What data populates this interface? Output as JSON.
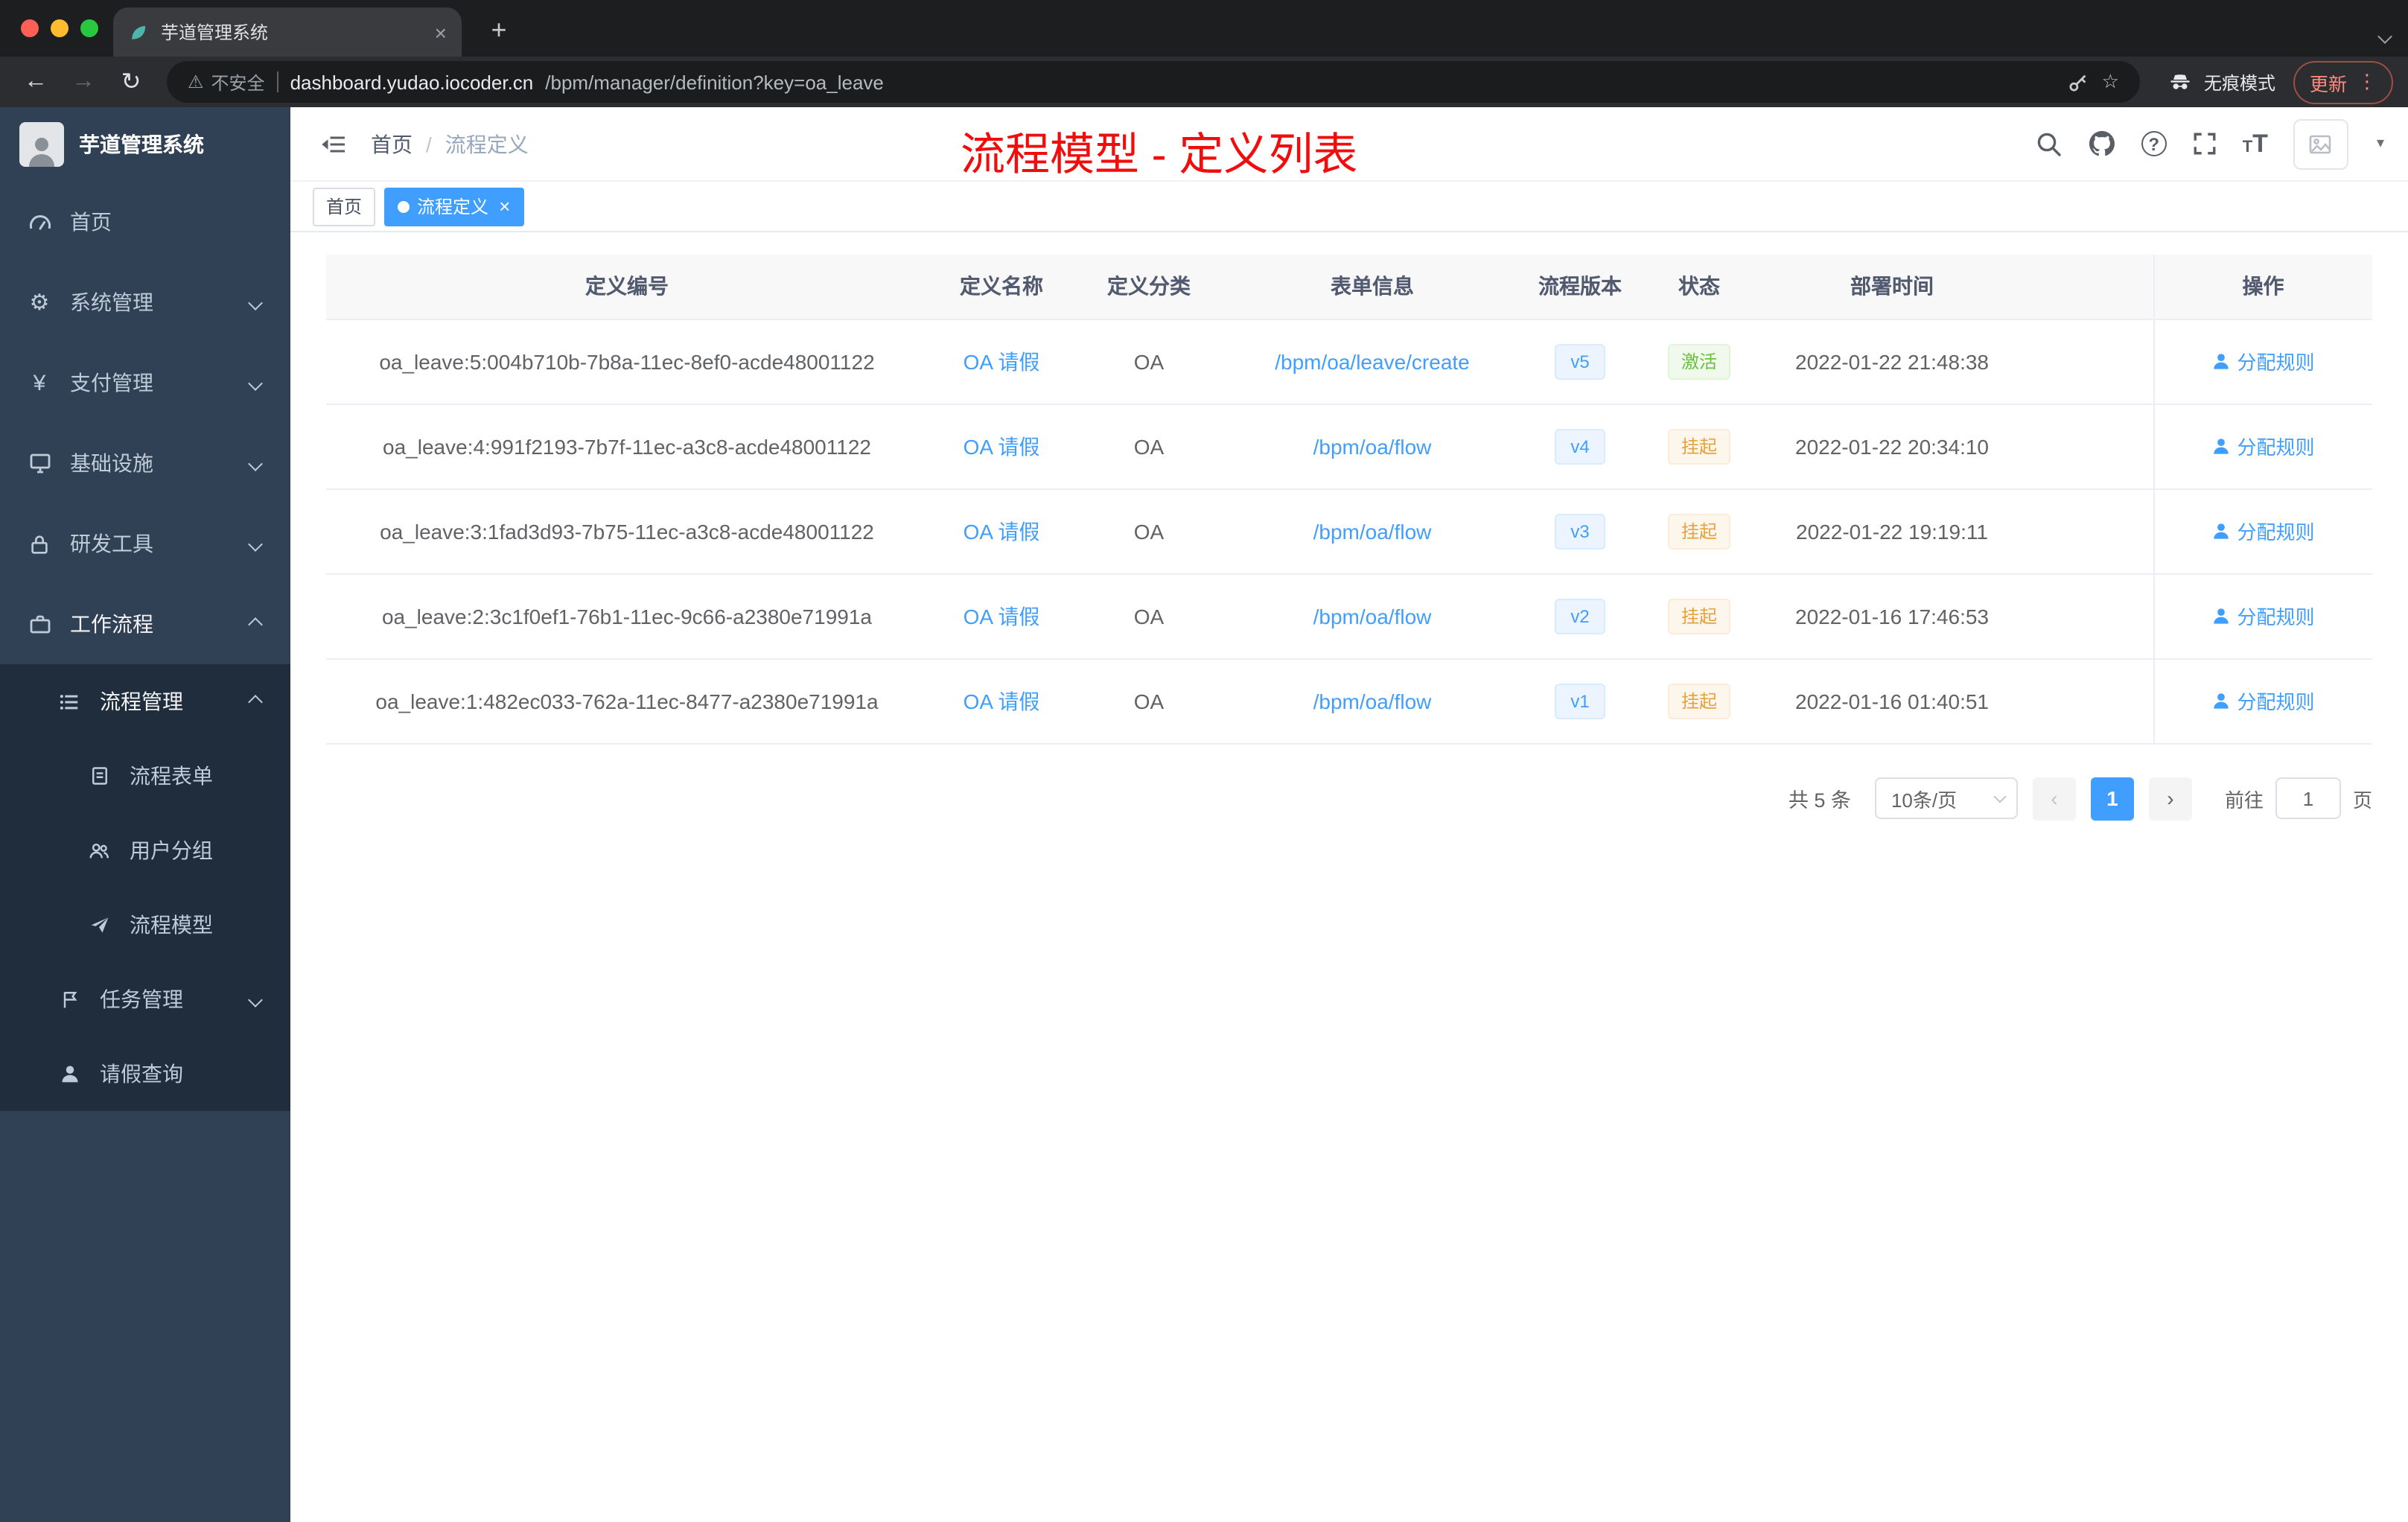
{
  "browser": {
    "tab_title": "芋道管理系统",
    "security_label": "不安全",
    "url_host": "dashboard.yudao.iocoder.cn",
    "url_path": "/bpm/manager/definition?key=oa_leave",
    "incognito_label": "无痕模式",
    "update_label": "更新"
  },
  "colors": {
    "accent": "#409eff",
    "success": "#67c23a",
    "warning": "#e6a23c",
    "title_red": "#f20d0d",
    "sidebar_bg": "#304156",
    "submenu_bg": "#1f2d3d"
  },
  "sidebar": {
    "logo_title": "芋道管理系统",
    "items": [
      {
        "label": "首页",
        "icon": "dashboard-icon"
      },
      {
        "label": "系统管理",
        "icon": "gear-icon"
      },
      {
        "label": "支付管理",
        "icon": "yen-icon"
      },
      {
        "label": "基础设施",
        "icon": "infrastructure-icon"
      },
      {
        "label": "研发工具",
        "icon": "dev-tools-icon"
      },
      {
        "label": "工作流程",
        "icon": "workflow-icon"
      }
    ],
    "workflow": {
      "process_mgmt": {
        "label": "流程管理",
        "icon": "process-list-icon"
      },
      "children": [
        {
          "label": "流程表单",
          "icon": "form-icon"
        },
        {
          "label": "用户分组",
          "icon": "user-group-icon"
        },
        {
          "label": "流程模型",
          "icon": "process-model-icon"
        }
      ],
      "task_mgmt": {
        "label": "任务管理",
        "icon": "task-flag-icon"
      },
      "leave_query": {
        "label": "请假查询",
        "icon": "person-icon"
      }
    }
  },
  "header": {
    "breadcrumb_home": "首页",
    "breadcrumb_separator": "/",
    "breadcrumb_current": "流程定义",
    "page_title": "流程模型 - 定义列表"
  },
  "tags": [
    {
      "label": "首页"
    },
    {
      "label": "流程定义"
    }
  ],
  "table": {
    "columns": [
      "定义编号",
      "定义名称",
      "定义分类",
      "表单信息",
      "流程版本",
      "状态",
      "部署时间",
      "操作"
    ],
    "rows": [
      {
        "id": "oa_leave:5:004b710b-7b8a-11ec-8ef0-acde48001122",
        "name": "OA 请假",
        "category": "OA",
        "form": "/bpm/oa/leave/create",
        "version": "v5",
        "status": "激活",
        "status_class": "el-tag t-success",
        "deploy_time": "2022-01-22 21:48:38",
        "action": "分配规则"
      },
      {
        "id": "oa_leave:4:991f2193-7b7f-11ec-a3c8-acde48001122",
        "name": "OA 请假",
        "category": "OA",
        "form": "/bpm/oa/flow",
        "version": "v4",
        "status": "挂起",
        "status_class": "el-tag t-warning",
        "deploy_time": "2022-01-22 20:34:10",
        "action": "分配规则"
      },
      {
        "id": "oa_leave:3:1fad3d93-7b75-11ec-a3c8-acde48001122",
        "name": "OA 请假",
        "category": "OA",
        "form": "/bpm/oa/flow",
        "version": "v3",
        "status": "挂起",
        "status_class": "el-tag t-warning",
        "deploy_time": "2022-01-22 19:19:11",
        "action": "分配规则"
      },
      {
        "id": "oa_leave:2:3c1f0ef1-76b1-11ec-9c66-a2380e71991a",
        "name": "OA 请假",
        "category": "OA",
        "form": "/bpm/oa/flow",
        "version": "v2",
        "status": "挂起",
        "status_class": "el-tag t-warning",
        "deploy_time": "2022-01-16 17:46:53",
        "action": "分配规则"
      },
      {
        "id": "oa_leave:1:482ec033-762a-11ec-8477-a2380e71991a",
        "name": "OA 请假",
        "category": "OA",
        "form": "/bpm/oa/flow",
        "version": "v1",
        "status": "挂起",
        "status_class": "el-tag t-warning",
        "deploy_time": "2022-01-16 01:40:51",
        "action": "分配规则"
      }
    ]
  },
  "pagination": {
    "total": "共 5 条",
    "page_size": "10条/页",
    "prev": "‹",
    "page": "1",
    "next": "›",
    "goto": "前往",
    "goto_value": "1",
    "unit": "页"
  }
}
